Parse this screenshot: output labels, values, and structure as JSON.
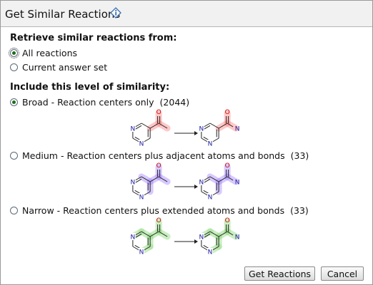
{
  "dialog": {
    "title": "Get Similar Reactions",
    "info_icon": "info-icon"
  },
  "retrieve": {
    "heading": "Retrieve similar reactions from:",
    "options": [
      {
        "label": "All reactions",
        "checked": true,
        "focused": true
      },
      {
        "label": "Current answer set",
        "checked": false
      }
    ]
  },
  "similarity": {
    "heading": "Include this level of similarity:",
    "options": [
      {
        "label": "Broad - Reaction centers only",
        "count": "(2044)",
        "checked": true,
        "highlight": "#ff9a9a"
      },
      {
        "label": "Medium - Reaction centers plus adjacent atoms and bonds",
        "count": "(33)",
        "checked": false,
        "highlight": "#b79cff"
      },
      {
        "label": "Narrow - Reaction centers plus extended atoms and bonds",
        "count": "(33)",
        "checked": false,
        "highlight": "#9fe08f"
      }
    ]
  },
  "atom_labels": {
    "n": "N",
    "o": "O"
  },
  "buttons": {
    "get_reactions": "Get Reactions",
    "cancel": "Cancel"
  }
}
